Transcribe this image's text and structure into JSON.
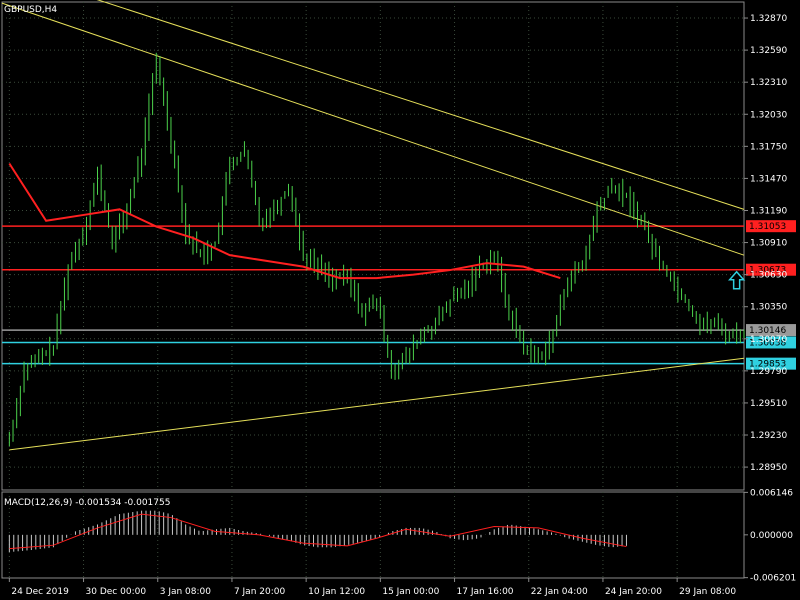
{
  "chart_data": {
    "type": "candlestick",
    "title": "GBPUSD,H4",
    "price_axis": {
      "ylim": [
        1.2875,
        1.3301
      ],
      "ticks": [
        "1.32870",
        "1.32590",
        "1.32310",
        "1.32030",
        "1.31750",
        "1.31470",
        "1.31190",
        "1.30910",
        "1.30630",
        "1.30350",
        "1.30070",
        "1.29790",
        "1.29510",
        "1.29230",
        "1.28950"
      ]
    },
    "time_axis": {
      "labels": [
        "24 Dec 2019",
        "30 Dec 00:00",
        "3 Jan 08:00",
        "7 Jan 20:00",
        "10 Jan 12:00",
        "15 Jan 00:00",
        "17 Jan 16:00",
        "22 Jan 04:00",
        "24 Jan 20:00",
        "29 Jan 08:00"
      ]
    },
    "price_points": [
      [
        0,
        1.292
      ],
      [
        2,
        1.298
      ],
      [
        4,
        1.299
      ],
      [
        6,
        1.3
      ],
      [
        8,
        1.307
      ],
      [
        10,
        1.31
      ],
      [
        12,
        1.315
      ],
      [
        14,
        1.309
      ],
      [
        16,
        1.312
      ],
      [
        18,
        1.317
      ],
      [
        20,
        1.325
      ],
      [
        22,
        1.318
      ],
      [
        24,
        1.31
      ],
      [
        26,
        1.308
      ],
      [
        28,
        1.309
      ],
      [
        30,
        1.316
      ],
      [
        32,
        1.317
      ],
      [
        34,
        1.311
      ],
      [
        36,
        1.312
      ],
      [
        38,
        1.314
      ],
      [
        40,
        1.308
      ],
      [
        42,
        1.307
      ],
      [
        44,
        1.306
      ],
      [
        46,
        1.306
      ],
      [
        48,
        1.303
      ],
      [
        50,
        1.304
      ],
      [
        52,
        1.298
      ],
      [
        54,
        1.299
      ],
      [
        56,
        1.301
      ],
      [
        58,
        1.302
      ],
      [
        60,
        1.304
      ],
      [
        62,
        1.305
      ],
      [
        64,
        1.307
      ],
      [
        66,
        1.308
      ],
      [
        68,
        1.303
      ],
      [
        70,
        1.3
      ],
      [
        72,
        1.299
      ],
      [
        74,
        1.301
      ],
      [
        76,
        1.306
      ],
      [
        78,
        1.307
      ],
      [
        80,
        1.312
      ],
      [
        82,
        1.314
      ],
      [
        84,
        1.313
      ],
      [
        86,
        1.311
      ],
      [
        88,
        1.308
      ],
      [
        90,
        1.306
      ],
      [
        92,
        1.304
      ],
      [
        94,
        1.302
      ],
      [
        96,
        1.302
      ],
      [
        98,
        1.301
      ],
      [
        100,
        1.3014
      ]
    ],
    "moving_average": {
      "color": "#ff2020",
      "points": [
        [
          0,
          1.316
        ],
        [
          5,
          1.311
        ],
        [
          10,
          1.3115
        ],
        [
          15,
          1.312
        ],
        [
          20,
          1.3105
        ],
        [
          25,
          1.3095
        ],
        [
          30,
          1.308
        ],
        [
          35,
          1.3075
        ],
        [
          40,
          1.307
        ],
        [
          45,
          1.306
        ],
        [
          50,
          1.306
        ],
        [
          55,
          1.3063
        ],
        [
          60,
          1.3067
        ],
        [
          65,
          1.3073
        ],
        [
          70,
          1.307
        ],
        [
          75,
          1.306
        ]
      ]
    },
    "horizontal_levels": [
      {
        "price": 1.31053,
        "label": "1.31053",
        "color": "#ff2020"
      },
      {
        "price": 1.30673,
        "label": "1.30673",
        "color": "#ff2020"
      },
      {
        "price": 1.30146,
        "label": "1.30146",
        "color": "#9a9a9a"
      },
      {
        "price": 1.30038,
        "label": "1.30038",
        "color": "#2fd0e0"
      },
      {
        "price": 1.29853,
        "label": "1.29853",
        "color": "#2fd0e0"
      }
    ],
    "trendlines": [
      {
        "from": [
          -1,
          1.333
        ],
        "to": [
          100,
          1.312
        ],
        "color": "#e6e05a"
      },
      {
        "from": [
          -1,
          1.33
        ],
        "to": [
          100,
          1.308
        ],
        "color": "#e6e05a"
      },
      {
        "from": [
          0,
          1.291
        ],
        "to": [
          100,
          1.299
        ],
        "color": "#e6e05a"
      }
    ],
    "arrow": {
      "position": [
        99,
        1.30673
      ],
      "color": "#2fd0e0",
      "direction": "up"
    },
    "macd": {
      "label": "MACD(12,26,9) -0.001534 -0.001755",
      "ylim": [
        -0.00625,
        0.0062
      ],
      "ticks": [
        "0.006146",
        "0.000000",
        "-0.006201"
      ],
      "histogram": [
        [
          0,
          -0.0025
        ],
        [
          3,
          -0.0022
        ],
        [
          6,
          -0.0018
        ],
        [
          9,
          0.0005
        ],
        [
          12,
          0.0015
        ],
        [
          15,
          0.003
        ],
        [
          18,
          0.0035
        ],
        [
          20,
          0.0035
        ],
        [
          22,
          0.003
        ],
        [
          24,
          0.0015
        ],
        [
          26,
          0.0005
        ],
        [
          28,
          0.0008
        ],
        [
          30,
          0.001
        ],
        [
          32,
          0.0005
        ],
        [
          34,
          0.0002
        ],
        [
          36,
          -0.0003
        ],
        [
          38,
          -0.0008
        ],
        [
          40,
          -0.0015
        ],
        [
          42,
          -0.0018
        ],
        [
          44,
          -0.0018
        ],
        [
          46,
          -0.0015
        ],
        [
          48,
          -0.001
        ],
        [
          50,
          -0.0005
        ],
        [
          52,
          0.0005
        ],
        [
          54,
          0.001
        ],
        [
          56,
          0.001
        ],
        [
          58,
          0.0005
        ],
        [
          60,
          -0.0005
        ],
        [
          62,
          -0.0008
        ],
        [
          64,
          -0.0005
        ],
        [
          66,
          0.0008
        ],
        [
          68,
          0.0015
        ],
        [
          70,
          0.0012
        ],
        [
          72,
          0.0008
        ],
        [
          74,
          0.0003
        ],
        [
          76,
          -0.0005
        ],
        [
          78,
          -0.001
        ],
        [
          80,
          -0.0015
        ],
        [
          82,
          -0.0018
        ],
        [
          84,
          -0.0016
        ]
      ],
      "signal": [
        [
          0,
          -0.002
        ],
        [
          6,
          -0.0015
        ],
        [
          12,
          0.001
        ],
        [
          18,
          0.003
        ],
        [
          22,
          0.0025
        ],
        [
          28,
          0.0005
        ],
        [
          34,
          0.0
        ],
        [
          40,
          -0.0012
        ],
        [
          46,
          -0.0016
        ],
        [
          50,
          -0.0005
        ],
        [
          54,
          0.0008
        ],
        [
          60,
          -0.0002
        ],
        [
          66,
          0.0012
        ],
        [
          72,
          0.001
        ],
        [
          78,
          -0.0005
        ],
        [
          84,
          -0.0017
        ]
      ]
    }
  }
}
